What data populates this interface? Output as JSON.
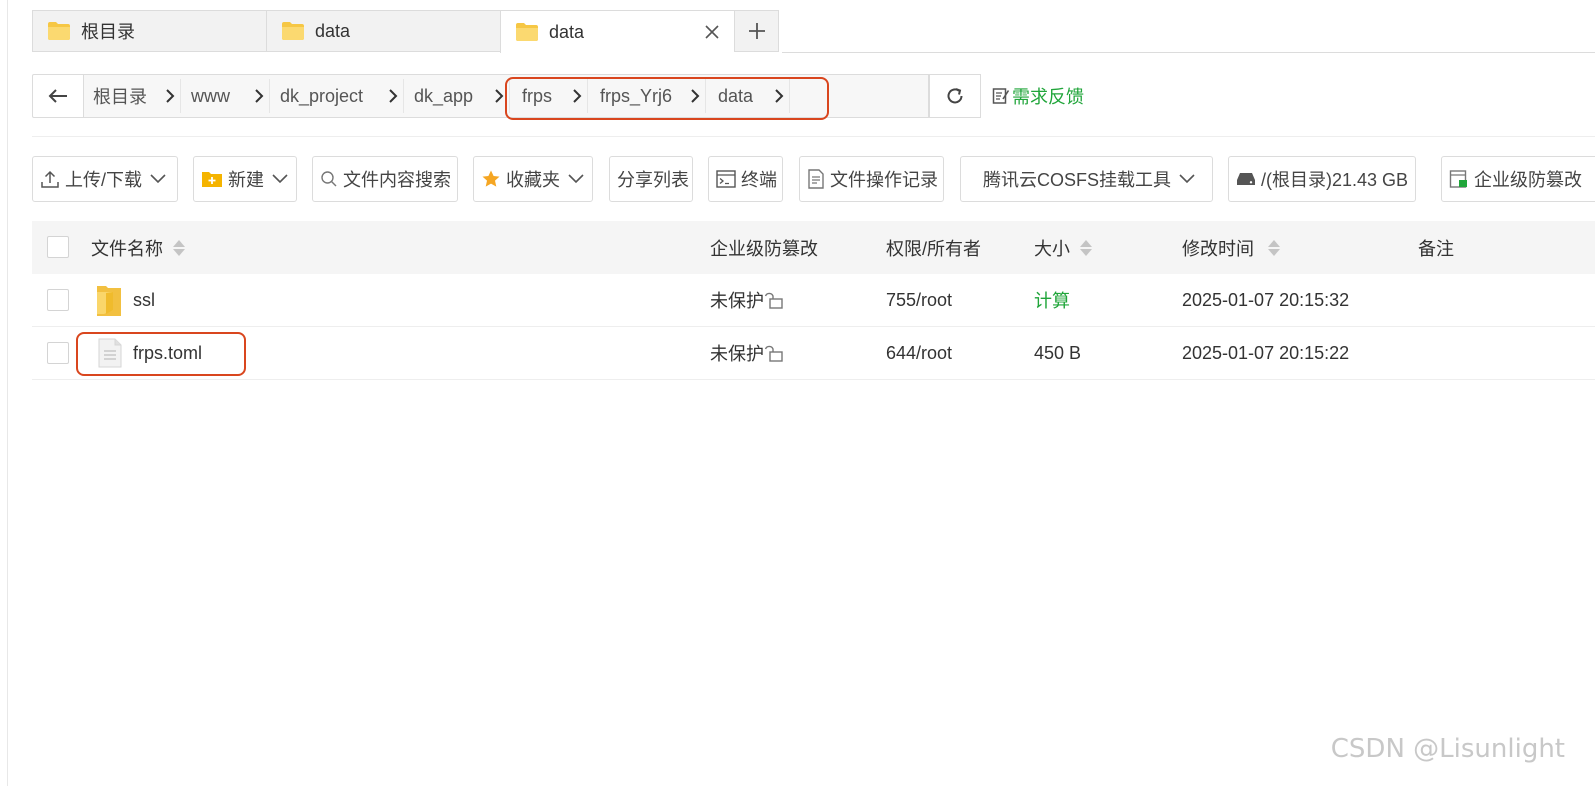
{
  "tabs": [
    {
      "label": "根目录",
      "icon": "folder-icon"
    },
    {
      "label": "data",
      "icon": "folder-icon"
    },
    {
      "label": "data",
      "icon": "folder-icon",
      "active": true
    }
  ],
  "addressbar": {
    "crumbs": [
      "根目录",
      "www",
      "dk_project",
      "dk_app",
      "frps",
      "frps_Yrj6",
      "data"
    ]
  },
  "feedback": {
    "label": "需求反馈",
    "color": "#20a53a"
  },
  "toolbar": {
    "upload": "上传/下载",
    "create": "新建",
    "search": "文件内容搜索",
    "favorites": "收藏夹",
    "share": "分享列表",
    "terminal": "终端",
    "oplog": "文件操作记录",
    "cosfs": "腾讯云COSFS挂载工具",
    "disk": "/(根目录)21.43 GB",
    "protect": "企业级防篡改"
  },
  "table": {
    "headers": {
      "name": "文件名称",
      "protect": "企业级防篡改",
      "perm": "权限/所有者",
      "size": "大小",
      "mtime": "修改时间",
      "note": "备注"
    },
    "rows": [
      {
        "name": "ssl",
        "type": "folder",
        "protect": "未保护",
        "perm": "755/root",
        "size": "计算",
        "mtime": "2025-01-07 20:15:32",
        "note": ""
      },
      {
        "name": "frps.toml",
        "type": "file",
        "protect": "未保护",
        "perm": "644/root",
        "size": "450 B",
        "mtime": "2025-01-07 20:15:22",
        "note": ""
      }
    ]
  },
  "colors": {
    "accent": "#20a53a",
    "highlight": "#d9461e"
  },
  "watermark": "CSDN @Lisunlight"
}
